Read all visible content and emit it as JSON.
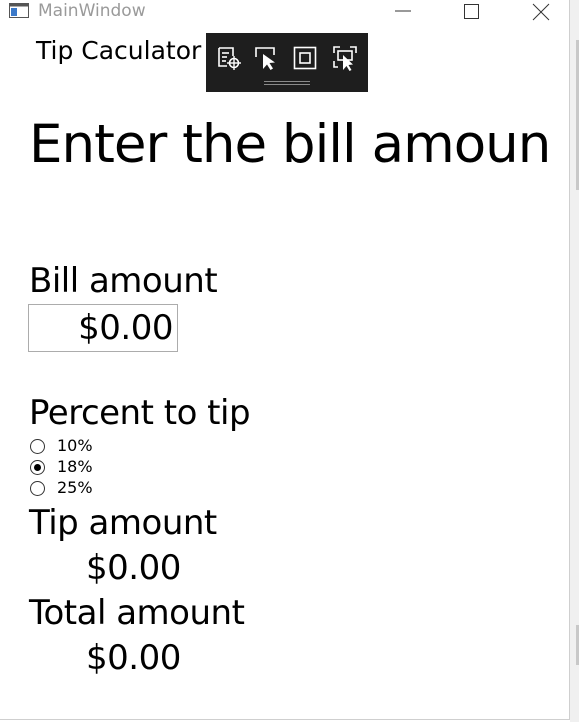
{
  "window": {
    "title": "MainWindow",
    "label": "Tip Caculator"
  },
  "main": {
    "heading": "Enter the bill amount",
    "bill": {
      "label": "Bill amount",
      "value": "$0.00"
    },
    "percent": {
      "label": "Percent to tip",
      "options": [
        {
          "label": "10%",
          "selected": false
        },
        {
          "label": "18%",
          "selected": true
        },
        {
          "label": "25%",
          "selected": false
        }
      ]
    },
    "tip": {
      "label": "Tip amount",
      "value": "$0.00"
    },
    "total": {
      "label": "Total amount",
      "value": "$0.00"
    }
  },
  "toolbar_icons": [
    "live-visual-tree-icon",
    "select-element-icon",
    "display-layout-adorners-icon",
    "track-focused-element-icon"
  ],
  "colors": {
    "toolbar_bg": "#1e1e1e",
    "title_text": "#9a9a9a"
  }
}
